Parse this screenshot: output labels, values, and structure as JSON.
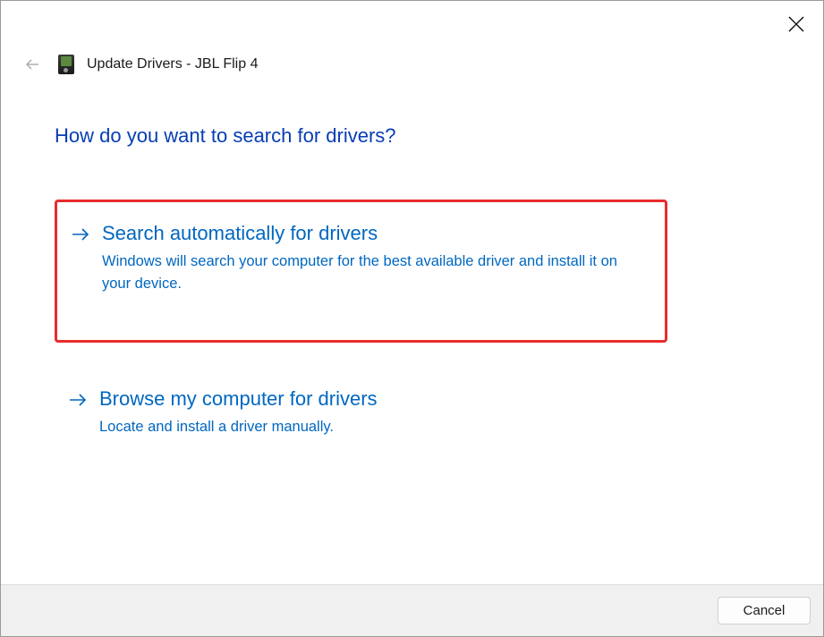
{
  "header": {
    "title": "Update Drivers - JBL Flip 4"
  },
  "content": {
    "question": "How do you want to search for drivers?",
    "options": [
      {
        "title": "Search automatically for drivers",
        "description": "Windows will search your computer for the best available driver and install it on your device."
      },
      {
        "title": "Browse my computer for drivers",
        "description": "Locate and install a driver manually."
      }
    ]
  },
  "footer": {
    "cancel_label": "Cancel"
  }
}
